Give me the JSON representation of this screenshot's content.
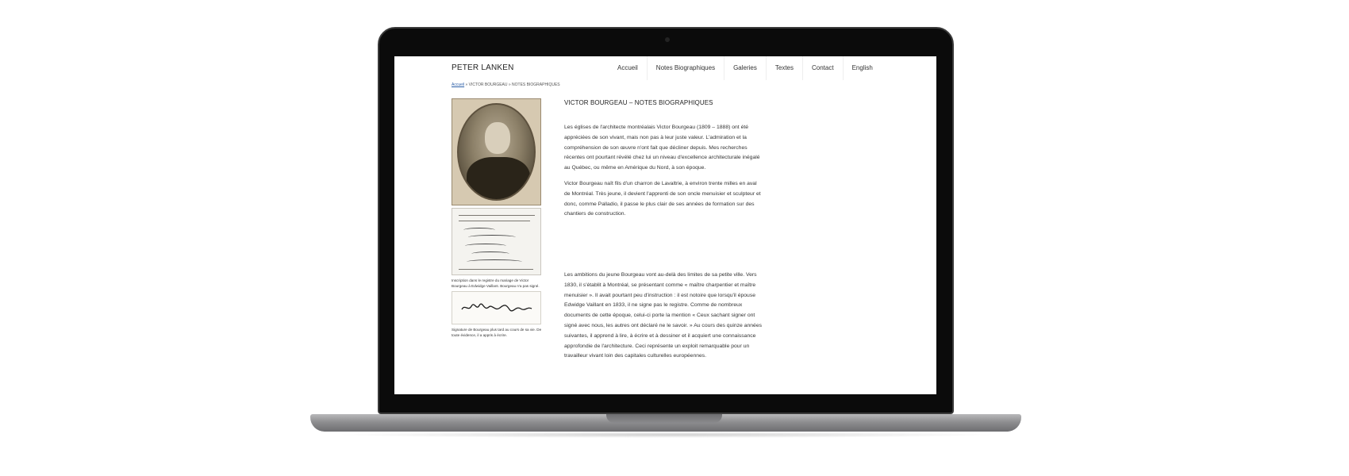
{
  "site": {
    "title": "PETER LANKEN",
    "nav": [
      "Accueil",
      "Notes Biographiques",
      "Galeries",
      "Textes",
      "Contact",
      "English"
    ]
  },
  "breadcrumb": {
    "home": "Accueil",
    "rest": " » VICTOR BOURGEAU » NOTES BIOGRAPHIQUES"
  },
  "page": {
    "heading": "VICTOR BOURGEAU – NOTES BIOGRAPHIQUES",
    "paragraphs": [
      "Les églises de l'architecte montréalais Victor Bourgeau (1809 – 1888) ont été appréciées de son vivant, mais non pas à leur juste valeur. L'admiration et la compréhension de son œuvre n'ont fait que décliner depuis. Mes recherches récentes ont pourtant révélé chez lui un niveau d'excellence architecturale inégalé au Québec, ou même en Amérique du Nord, à son époque.",
      "Victor Bourgeau naît fils d'un charron de Lavaltrie, à environ trente milles en aval de Montréal. Très jeune, il devient l'apprenti de son oncle menuisier et sculpteur et donc, comme Palladio, il passe le plus clair de ses années de formation sur des chantiers de construction.",
      "Les ambitions du jeune Bourgeau vont au-delà des limites de sa petite ville. Vers 1830, il s'établit à Montréal, se présentant comme « maître charpentier et maître menuisier ». Il avait pourtant peu d'instruction : il est notoire que lorsqu'il épouse Edwidge Vaillant en 1833, il ne signe pas le registre. Comme de nombreux documents de cette époque, celui-ci porte la mention « Ceux sachant signer ont signé avec nous, les autres ont déclaré ne le savoir. » Au cours des quinze années suivantes, il apprend à lire, à écrire et à dessiner et il acquiert une connaissance approfondie de l'architecture. Ceci représente un exploit remarquable pour un travailleur vivant loin des capitales culturelles européennes."
    ]
  },
  "captions": {
    "marriage_register": "Inscription dans le registre du mariage de Victor Bourgeau à Edwidge Vaillant. Bourgeau n'a pas signé.",
    "signature": "Signature de Bourgeau plus tard au cours de sa vie. De toute évidence, il a appris à écrire."
  },
  "colors": {
    "laptop_frame": "#0b0b0b",
    "laptop_base": "#8e8e90",
    "link": "#2b5ea7"
  }
}
